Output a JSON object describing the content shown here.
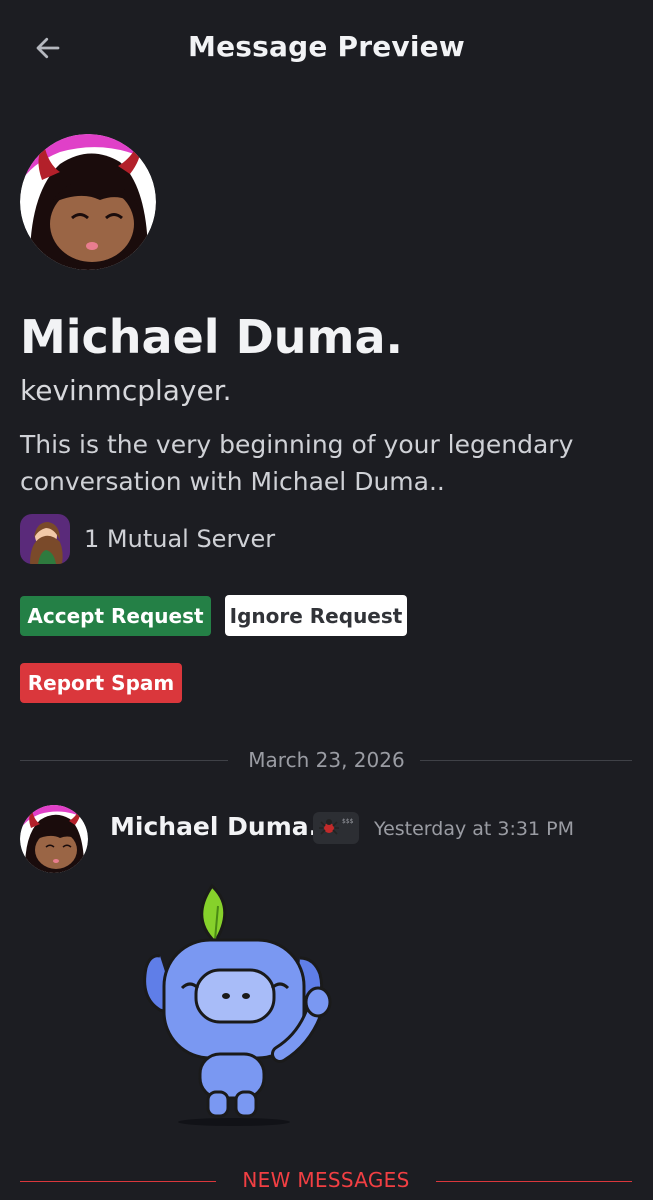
{
  "header": {
    "title": "Message Preview",
    "back_icon": "arrow-left-icon"
  },
  "profile": {
    "display_name": "Michael Duma.",
    "username": "kevinmcplayer.",
    "intro": "This is the very beginning of your legendary conversation with Michael Duma..",
    "mutual_servers": "1 Mutual Server"
  },
  "actions": {
    "accept": "Accept Request",
    "ignore": "Ignore Request",
    "spam": "Report Spam"
  },
  "chat": {
    "date_divider": "March 23, 2026",
    "message": {
      "author": "Michael Duma.",
      "timestamp": "Yesterday at 3:31 PM"
    },
    "new_messages_label": "NEW MESSAGES"
  },
  "colors": {
    "background": "#1c1d22",
    "accept": "#248046",
    "spam": "#da373c",
    "new_messages": "#f23f43"
  }
}
